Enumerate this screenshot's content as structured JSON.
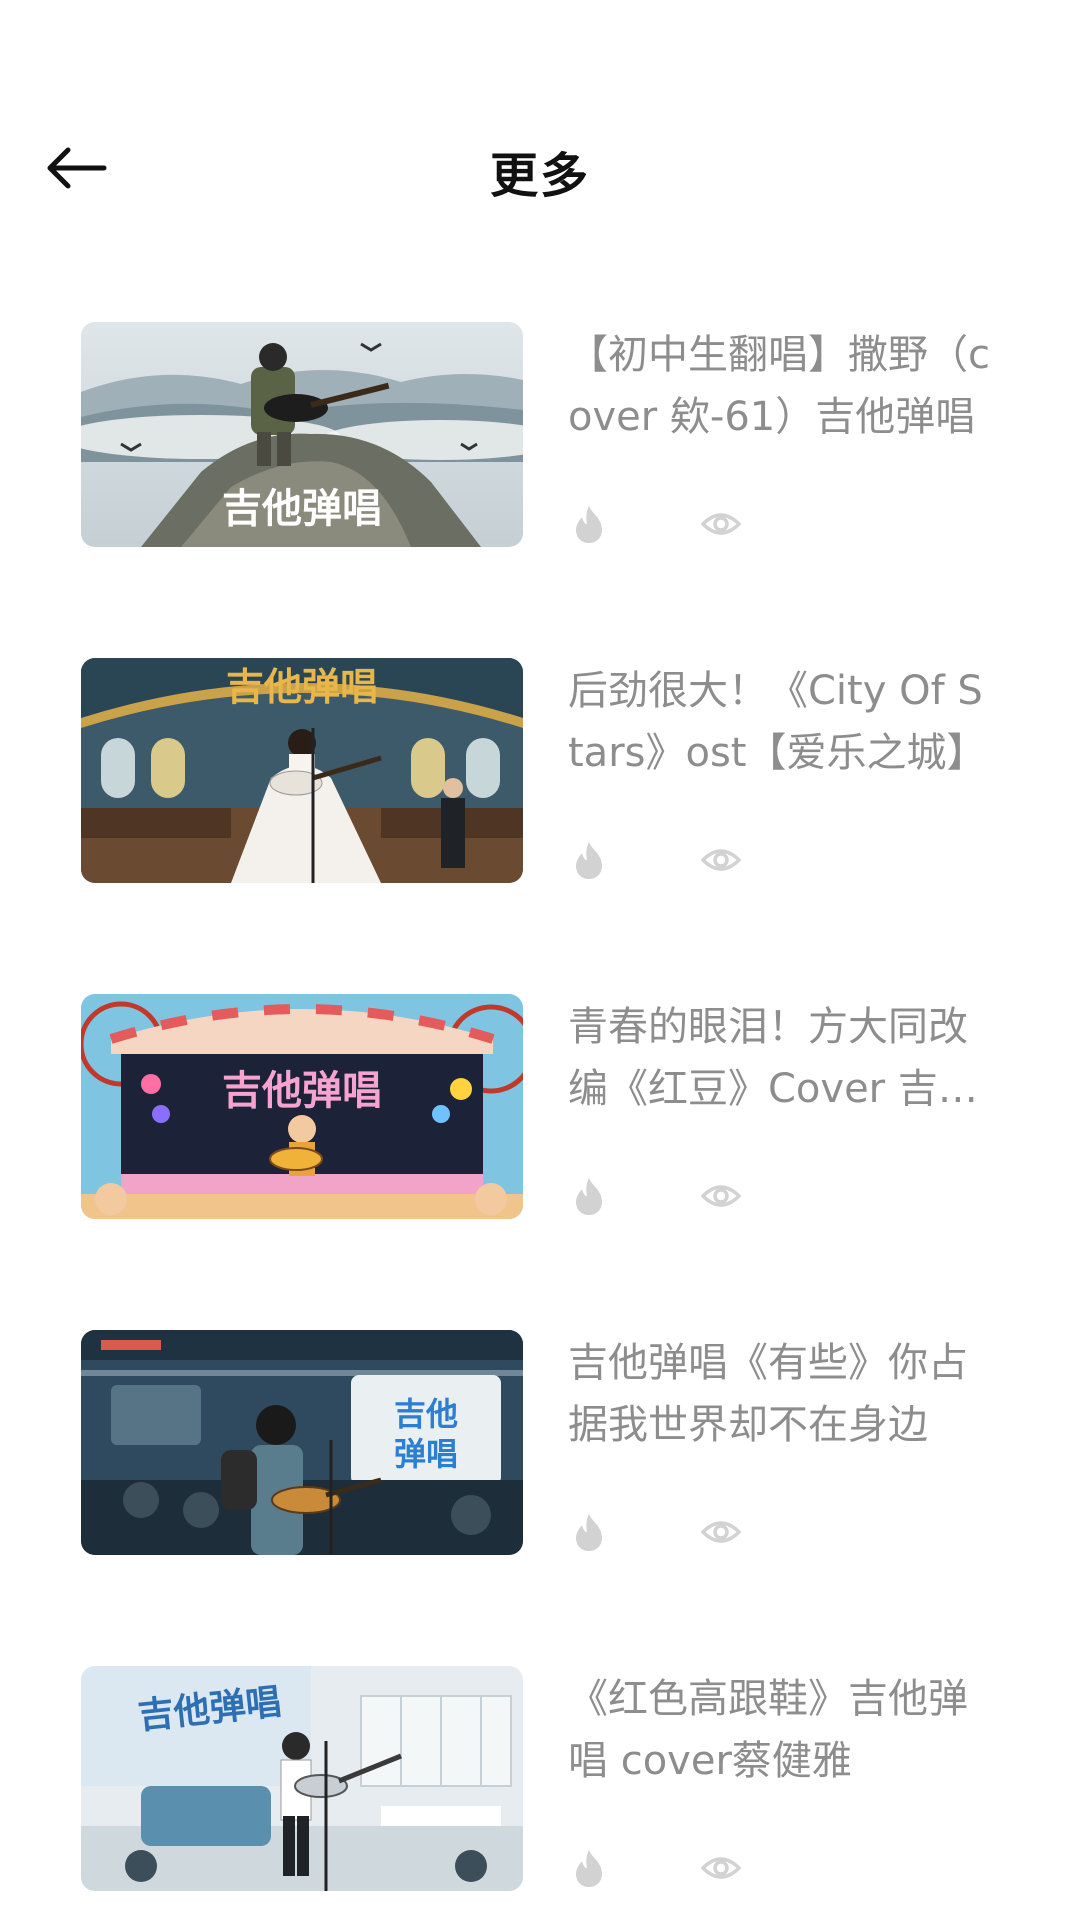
{
  "header": {
    "back_icon": "arrow-left-icon",
    "title": "更多"
  },
  "items": [
    {
      "title": "【初中生翻唱】撒野（cover 欸-61）吉他弹唱",
      "thumb_text": "吉他弹唱",
      "hot_count": "",
      "view_count": ""
    },
    {
      "title": "后劲很大！《City Of Stars》ost【爱乐之城】",
      "thumb_text": "吉他弹唱",
      "hot_count": "",
      "view_count": ""
    },
    {
      "title": "青春的眼泪！方大同改编《红豆》Cover 吉他弹唱",
      "thumb_text": "吉他弹唱",
      "hot_count": "",
      "view_count": ""
    },
    {
      "title": "吉他弹唱《有些》你占据我世界却不在身边",
      "thumb_text": "吉他弹唱",
      "hot_count": "",
      "view_count": ""
    },
    {
      "title": "《红色高跟鞋》吉他弹唱 cover蔡健雅",
      "thumb_text": "吉他弹唱",
      "hot_count": "",
      "view_count": ""
    }
  ],
  "icons": {
    "hot": "flame-icon",
    "views": "eye-icon"
  },
  "colors": {
    "title_text": "#111111",
    "item_text": "#8d8d8d",
    "icon_gray": "#d2d2d2"
  }
}
